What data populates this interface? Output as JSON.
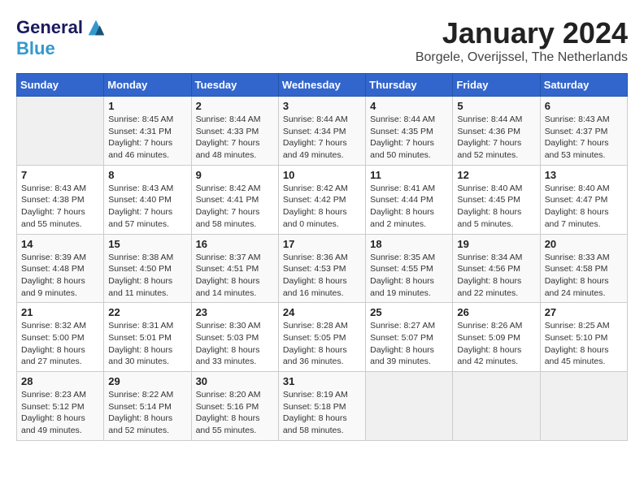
{
  "header": {
    "logo_line1": "General",
    "logo_line2": "Blue",
    "month_year": "January 2024",
    "location": "Borgele, Overijssel, The Netherlands"
  },
  "days_of_week": [
    "Sunday",
    "Monday",
    "Tuesday",
    "Wednesday",
    "Thursday",
    "Friday",
    "Saturday"
  ],
  "weeks": [
    [
      {
        "day": "",
        "sunrise": "",
        "sunset": "",
        "daylight": ""
      },
      {
        "day": "1",
        "sunrise": "Sunrise: 8:45 AM",
        "sunset": "Sunset: 4:31 PM",
        "daylight": "Daylight: 7 hours and 46 minutes."
      },
      {
        "day": "2",
        "sunrise": "Sunrise: 8:44 AM",
        "sunset": "Sunset: 4:33 PM",
        "daylight": "Daylight: 7 hours and 48 minutes."
      },
      {
        "day": "3",
        "sunrise": "Sunrise: 8:44 AM",
        "sunset": "Sunset: 4:34 PM",
        "daylight": "Daylight: 7 hours and 49 minutes."
      },
      {
        "day": "4",
        "sunrise": "Sunrise: 8:44 AM",
        "sunset": "Sunset: 4:35 PM",
        "daylight": "Daylight: 7 hours and 50 minutes."
      },
      {
        "day": "5",
        "sunrise": "Sunrise: 8:44 AM",
        "sunset": "Sunset: 4:36 PM",
        "daylight": "Daylight: 7 hours and 52 minutes."
      },
      {
        "day": "6",
        "sunrise": "Sunrise: 8:43 AM",
        "sunset": "Sunset: 4:37 PM",
        "daylight": "Daylight: 7 hours and 53 minutes."
      }
    ],
    [
      {
        "day": "7",
        "sunrise": "Sunrise: 8:43 AM",
        "sunset": "Sunset: 4:38 PM",
        "daylight": "Daylight: 7 hours and 55 minutes."
      },
      {
        "day": "8",
        "sunrise": "Sunrise: 8:43 AM",
        "sunset": "Sunset: 4:40 PM",
        "daylight": "Daylight: 7 hours and 57 minutes."
      },
      {
        "day": "9",
        "sunrise": "Sunrise: 8:42 AM",
        "sunset": "Sunset: 4:41 PM",
        "daylight": "Daylight: 7 hours and 58 minutes."
      },
      {
        "day": "10",
        "sunrise": "Sunrise: 8:42 AM",
        "sunset": "Sunset: 4:42 PM",
        "daylight": "Daylight: 8 hours and 0 minutes."
      },
      {
        "day": "11",
        "sunrise": "Sunrise: 8:41 AM",
        "sunset": "Sunset: 4:44 PM",
        "daylight": "Daylight: 8 hours and 2 minutes."
      },
      {
        "day": "12",
        "sunrise": "Sunrise: 8:40 AM",
        "sunset": "Sunset: 4:45 PM",
        "daylight": "Daylight: 8 hours and 5 minutes."
      },
      {
        "day": "13",
        "sunrise": "Sunrise: 8:40 AM",
        "sunset": "Sunset: 4:47 PM",
        "daylight": "Daylight: 8 hours and 7 minutes."
      }
    ],
    [
      {
        "day": "14",
        "sunrise": "Sunrise: 8:39 AM",
        "sunset": "Sunset: 4:48 PM",
        "daylight": "Daylight: 8 hours and 9 minutes."
      },
      {
        "day": "15",
        "sunrise": "Sunrise: 8:38 AM",
        "sunset": "Sunset: 4:50 PM",
        "daylight": "Daylight: 8 hours and 11 minutes."
      },
      {
        "day": "16",
        "sunrise": "Sunrise: 8:37 AM",
        "sunset": "Sunset: 4:51 PM",
        "daylight": "Daylight: 8 hours and 14 minutes."
      },
      {
        "day": "17",
        "sunrise": "Sunrise: 8:36 AM",
        "sunset": "Sunset: 4:53 PM",
        "daylight": "Daylight: 8 hours and 16 minutes."
      },
      {
        "day": "18",
        "sunrise": "Sunrise: 8:35 AM",
        "sunset": "Sunset: 4:55 PM",
        "daylight": "Daylight: 8 hours and 19 minutes."
      },
      {
        "day": "19",
        "sunrise": "Sunrise: 8:34 AM",
        "sunset": "Sunset: 4:56 PM",
        "daylight": "Daylight: 8 hours and 22 minutes."
      },
      {
        "day": "20",
        "sunrise": "Sunrise: 8:33 AM",
        "sunset": "Sunset: 4:58 PM",
        "daylight": "Daylight: 8 hours and 24 minutes."
      }
    ],
    [
      {
        "day": "21",
        "sunrise": "Sunrise: 8:32 AM",
        "sunset": "Sunset: 5:00 PM",
        "daylight": "Daylight: 8 hours and 27 minutes."
      },
      {
        "day": "22",
        "sunrise": "Sunrise: 8:31 AM",
        "sunset": "Sunset: 5:01 PM",
        "daylight": "Daylight: 8 hours and 30 minutes."
      },
      {
        "day": "23",
        "sunrise": "Sunrise: 8:30 AM",
        "sunset": "Sunset: 5:03 PM",
        "daylight": "Daylight: 8 hours and 33 minutes."
      },
      {
        "day": "24",
        "sunrise": "Sunrise: 8:28 AM",
        "sunset": "Sunset: 5:05 PM",
        "daylight": "Daylight: 8 hours and 36 minutes."
      },
      {
        "day": "25",
        "sunrise": "Sunrise: 8:27 AM",
        "sunset": "Sunset: 5:07 PM",
        "daylight": "Daylight: 8 hours and 39 minutes."
      },
      {
        "day": "26",
        "sunrise": "Sunrise: 8:26 AM",
        "sunset": "Sunset: 5:09 PM",
        "daylight": "Daylight: 8 hours and 42 minutes."
      },
      {
        "day": "27",
        "sunrise": "Sunrise: 8:25 AM",
        "sunset": "Sunset: 5:10 PM",
        "daylight": "Daylight: 8 hours and 45 minutes."
      }
    ],
    [
      {
        "day": "28",
        "sunrise": "Sunrise: 8:23 AM",
        "sunset": "Sunset: 5:12 PM",
        "daylight": "Daylight: 8 hours and 49 minutes."
      },
      {
        "day": "29",
        "sunrise": "Sunrise: 8:22 AM",
        "sunset": "Sunset: 5:14 PM",
        "daylight": "Daylight: 8 hours and 52 minutes."
      },
      {
        "day": "30",
        "sunrise": "Sunrise: 8:20 AM",
        "sunset": "Sunset: 5:16 PM",
        "daylight": "Daylight: 8 hours and 55 minutes."
      },
      {
        "day": "31",
        "sunrise": "Sunrise: 8:19 AM",
        "sunset": "Sunset: 5:18 PM",
        "daylight": "Daylight: 8 hours and 58 minutes."
      },
      {
        "day": "",
        "sunrise": "",
        "sunset": "",
        "daylight": ""
      },
      {
        "day": "",
        "sunrise": "",
        "sunset": "",
        "daylight": ""
      },
      {
        "day": "",
        "sunrise": "",
        "sunset": "",
        "daylight": ""
      }
    ]
  ]
}
